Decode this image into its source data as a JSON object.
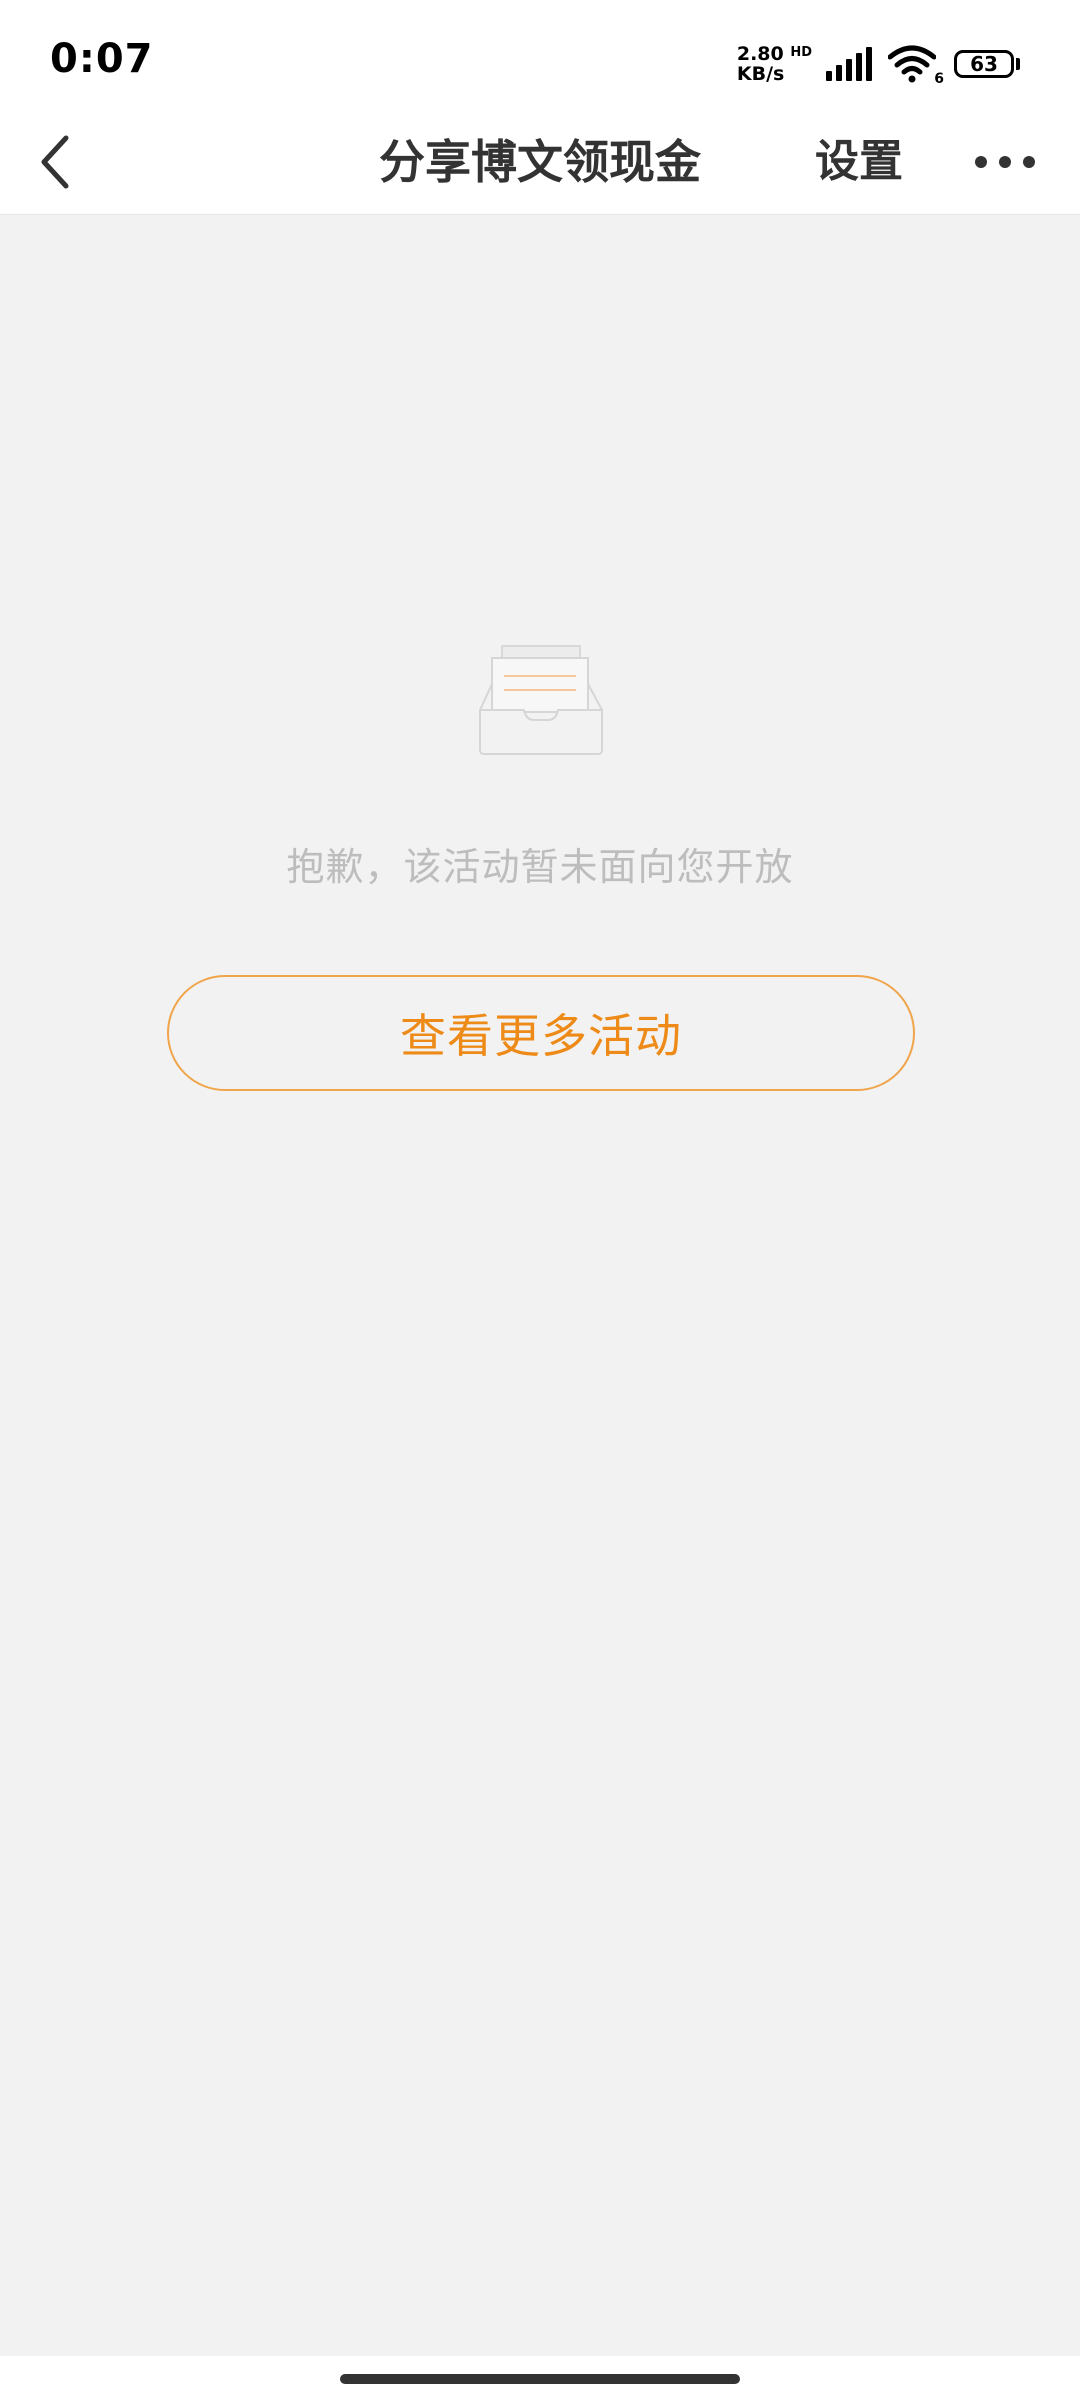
{
  "status_bar": {
    "time": "0:07",
    "net_speed_value": "2.80",
    "net_speed_unit": "KB/s",
    "hd": "HD",
    "wifi_badge": "6",
    "battery": "63"
  },
  "nav": {
    "title": "分享博文领现金",
    "settings_label": "设置"
  },
  "content": {
    "empty_message": "抱歉，该活动暂未面向您开放",
    "more_activities_label": "查看更多活动"
  },
  "colors": {
    "accent": "#ee8a17",
    "background": "#f2f2f2",
    "text_primary": "#333333",
    "text_muted": "#bdbdbd"
  },
  "icons": {
    "back": "chevron-left-icon",
    "more": "more-horizontal-icon",
    "empty": "empty-inbox-icon",
    "signal": "signal-icon",
    "wifi": "wifi-icon",
    "battery": "battery-icon"
  }
}
